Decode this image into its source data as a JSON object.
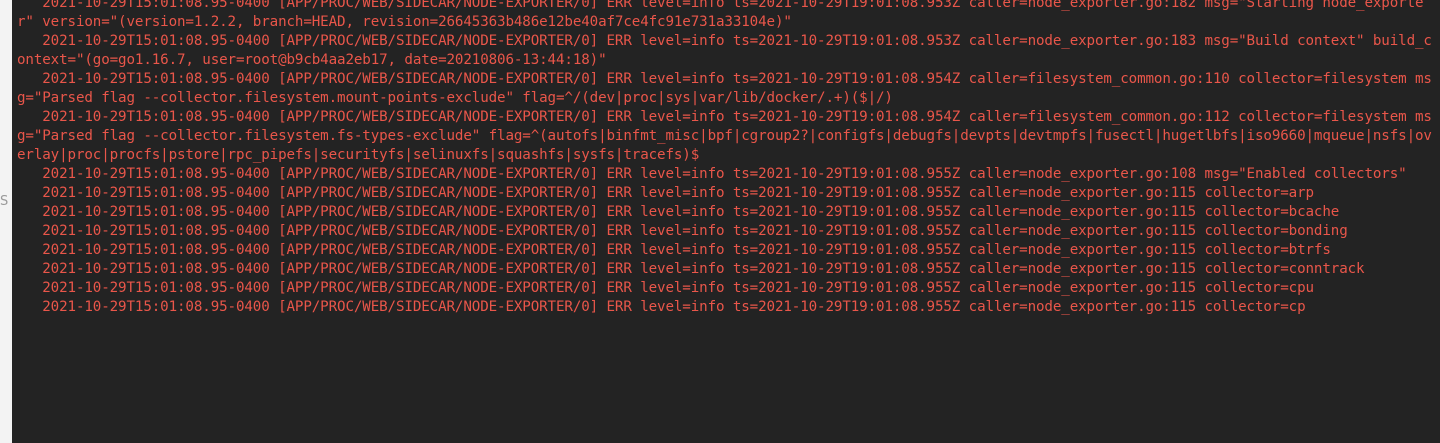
{
  "window": {
    "background": "#232323",
    "text_color": "#e9564a"
  },
  "edge_glyph": "S",
  "log_lines": [
    "   2021-10-29T15:01:08.95-0400 [APP/PROC/WEB/SIDECAR/NODE-EXPORTER/0] ERR level=info ts=2021-10-29T19:01:08.953Z caller=node_exporter.go:182 msg=\"Starting node_exporter\" version=\"(version=1.2.2, branch=HEAD, revision=26645363b486e12be40af7ce4fc91e731a33104e)\"",
    "   2021-10-29T15:01:08.95-0400 [APP/PROC/WEB/SIDECAR/NODE-EXPORTER/0] ERR level=info ts=2021-10-29T19:01:08.953Z caller=node_exporter.go:183 msg=\"Build context\" build_context=\"(go=go1.16.7, user=root@b9cb4aa2eb17, date=20210806-13:44:18)\"",
    "   2021-10-29T15:01:08.95-0400 [APP/PROC/WEB/SIDECAR/NODE-EXPORTER/0] ERR level=info ts=2021-10-29T19:01:08.954Z caller=filesystem_common.go:110 collector=filesystem msg=\"Parsed flag --collector.filesystem.mount-points-exclude\" flag=^/(dev|proc|sys|var/lib/docker/.+)($|/)",
    "   2021-10-29T15:01:08.95-0400 [APP/PROC/WEB/SIDECAR/NODE-EXPORTER/0] ERR level=info ts=2021-10-29T19:01:08.954Z caller=filesystem_common.go:112 collector=filesystem msg=\"Parsed flag --collector.filesystem.fs-types-exclude\" flag=^(autofs|binfmt_misc|bpf|cgroup2?|configfs|debugfs|devpts|devtmpfs|fusectl|hugetlbfs|iso9660|mqueue|nsfs|overlay|proc|procfs|pstore|rpc_pipefs|securityfs|selinuxfs|squashfs|sysfs|tracefs)$",
    "   2021-10-29T15:01:08.95-0400 [APP/PROC/WEB/SIDECAR/NODE-EXPORTER/0] ERR level=info ts=2021-10-29T19:01:08.955Z caller=node_exporter.go:108 msg=\"Enabled collectors\"",
    "   2021-10-29T15:01:08.95-0400 [APP/PROC/WEB/SIDECAR/NODE-EXPORTER/0] ERR level=info ts=2021-10-29T19:01:08.955Z caller=node_exporter.go:115 collector=arp",
    "   2021-10-29T15:01:08.95-0400 [APP/PROC/WEB/SIDECAR/NODE-EXPORTER/0] ERR level=info ts=2021-10-29T19:01:08.955Z caller=node_exporter.go:115 collector=bcache",
    "   2021-10-29T15:01:08.95-0400 [APP/PROC/WEB/SIDECAR/NODE-EXPORTER/0] ERR level=info ts=2021-10-29T19:01:08.955Z caller=node_exporter.go:115 collector=bonding",
    "   2021-10-29T15:01:08.95-0400 [APP/PROC/WEB/SIDECAR/NODE-EXPORTER/0] ERR level=info ts=2021-10-29T19:01:08.955Z caller=node_exporter.go:115 collector=btrfs",
    "   2021-10-29T15:01:08.95-0400 [APP/PROC/WEB/SIDECAR/NODE-EXPORTER/0] ERR level=info ts=2021-10-29T19:01:08.955Z caller=node_exporter.go:115 collector=conntrack",
    "   2021-10-29T15:01:08.95-0400 [APP/PROC/WEB/SIDECAR/NODE-EXPORTER/0] ERR level=info ts=2021-10-29T19:01:08.955Z caller=node_exporter.go:115 collector=cpu",
    "   2021-10-29T15:01:08.95-0400 [APP/PROC/WEB/SIDECAR/NODE-EXPORTER/0] ERR level=info ts=2021-10-29T19:01:08.955Z caller=node_exporter.go:115 collector=cp"
  ]
}
